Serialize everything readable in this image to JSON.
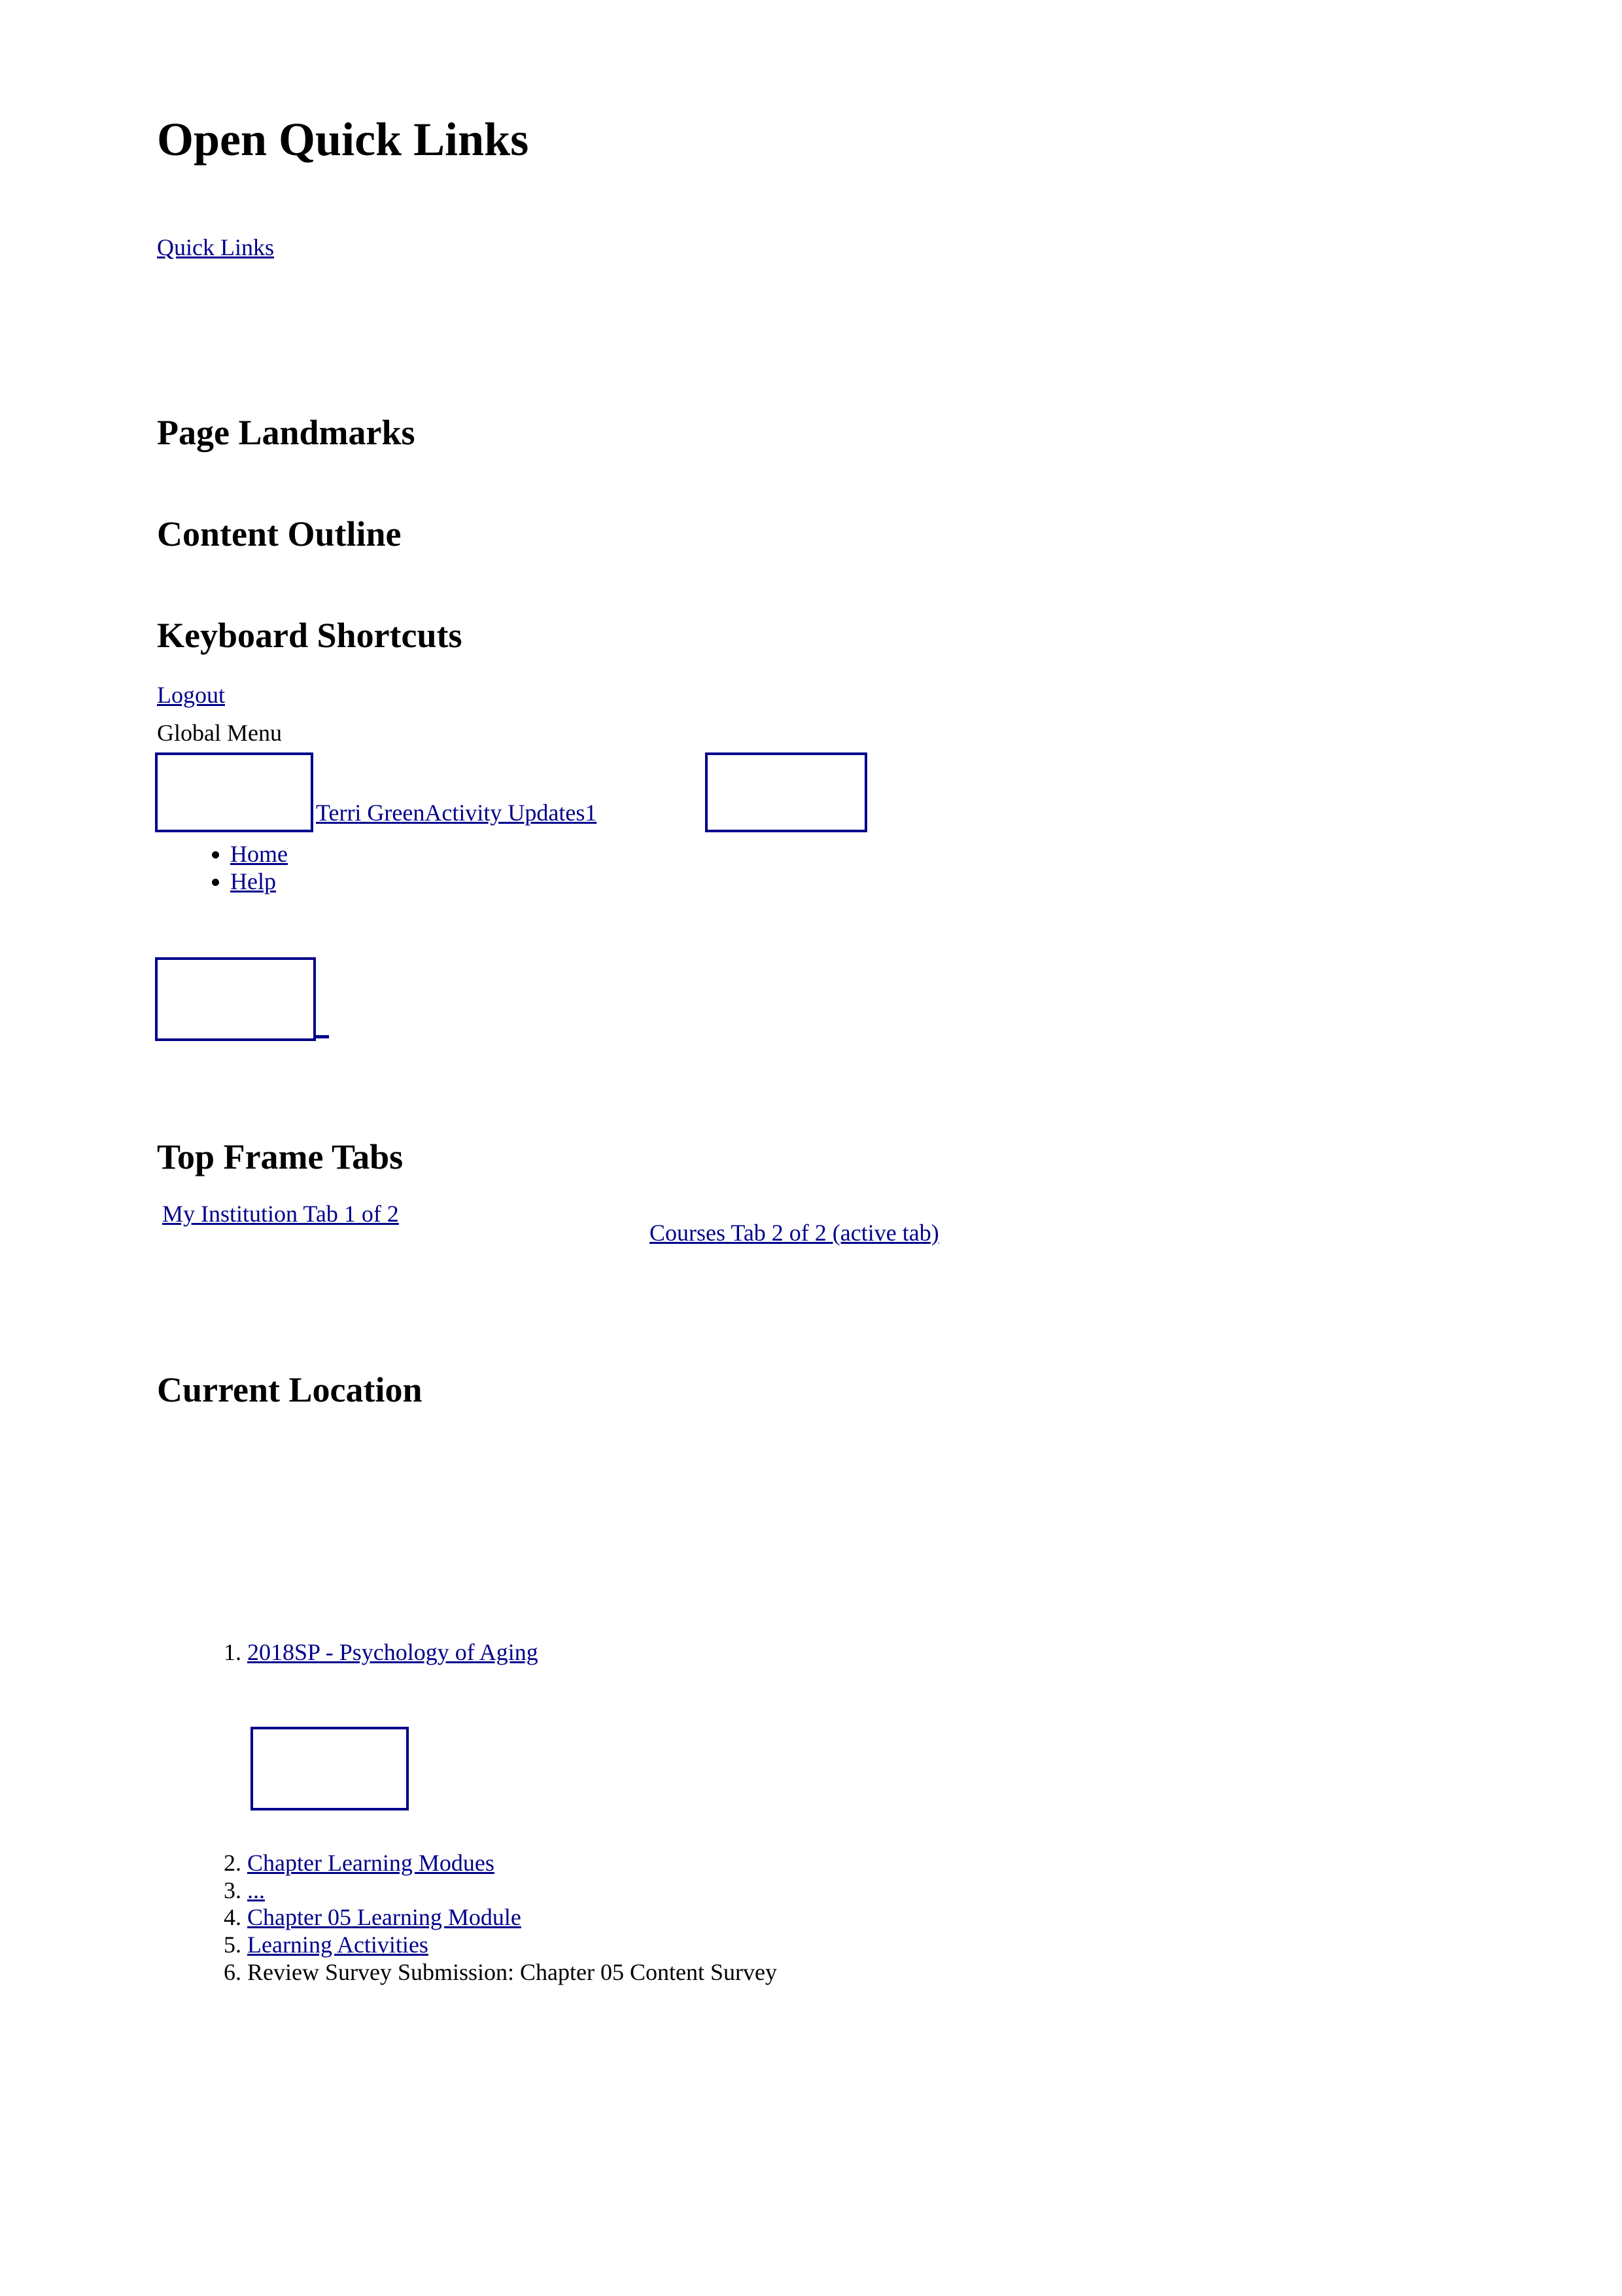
{
  "page": {
    "title": "Open Quick Links",
    "quick_links_label": "Quick Links"
  },
  "colors": {
    "link": "#00008b",
    "text": "#000000",
    "background": "#ffffff",
    "image_placeholder_border": "#00008b"
  },
  "sections": {
    "page_landmarks": "Page Landmarks",
    "content_outline": "Content Outline",
    "keyboard_shortcuts": "Keyboard Shortcuts",
    "top_frame_tabs": "Top Frame Tabs",
    "current_location": "Current Location"
  },
  "shortcuts": {
    "logout_label": "Logout",
    "global_menu_label": "Global Menu",
    "global_identity_label": "Terri GreenActivity Updates1",
    "avatar_image_alt": "",
    "activity_updates_image_alt": "",
    "menu_image_alt": "",
    "menu_items": [
      {
        "label": "Home"
      },
      {
        "label": "Help"
      }
    ]
  },
  "top_frame_tabs": [
    {
      "label": "My Institution Tab 1 of 2 ",
      "active": false
    },
    {
      "label": "Courses Tab 2 of 2 (active tab)",
      "active": true
    }
  ],
  "current_location": {
    "breadcrumb": [
      {
        "label": "2018SP - Psychology of Aging ",
        "is_link": true
      },
      {
        "label": "Chapter Learning Modues ",
        "is_link": true
      },
      {
        "label": "...",
        "is_link": true
      },
      {
        "label": "Chapter 05 Learning Module ",
        "is_link": true
      },
      {
        "label": "Learning Activities ",
        "is_link": true
      },
      {
        "label": "Review Survey Submission: Chapter 05 Content Survey",
        "is_link": false
      }
    ],
    "course_image_alt": ""
  }
}
